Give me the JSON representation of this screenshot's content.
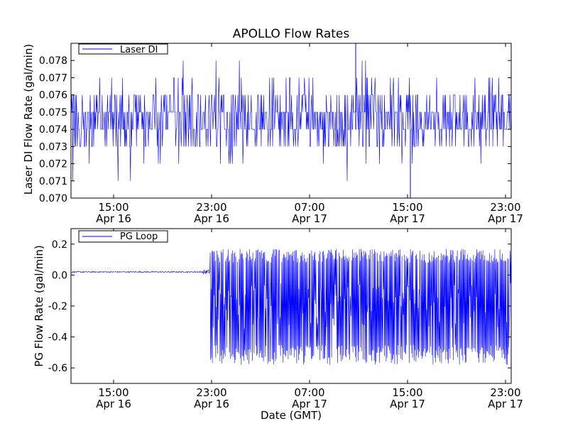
{
  "figure": {
    "title": "APOLLO Flow Rates",
    "xlabel": "Date (GMT)"
  },
  "colors": {
    "line": "#0000ff",
    "axes": "#000000",
    "background": "#ffffff"
  },
  "chart_data": [
    {
      "type": "line",
      "title": "APOLLO Flow Rates",
      "xlabel": "",
      "ylabel": "Laser DI Flow Rate (gal/min)",
      "x_range": [
        "Apr 16 10:30",
        "Apr 17 23:30"
      ],
      "ylim": [
        0.07,
        0.079
      ],
      "yticks": [
        "0.070",
        "0.071",
        "0.072",
        "0.073",
        "0.074",
        "0.075",
        "0.076",
        "0.077",
        "0.078"
      ],
      "xticks": [
        {
          "time": "15:00",
          "date": "Apr 16"
        },
        {
          "time": "23:00",
          "date": "Apr 16"
        },
        {
          "time": "07:00",
          "date": "Apr 17"
        },
        {
          "time": "15:00",
          "date": "Apr 17"
        },
        {
          "time": "23:00",
          "date": "Apr 17"
        }
      ],
      "legend": {
        "position": "top-left"
      },
      "grid": false,
      "series": [
        {
          "name": "Laser DI",
          "description_values": {
            "baseline": 0.0745,
            "typical_min": 0.073,
            "typical_max": 0.076,
            "min": 0.07,
            "max": 0.079
          }
        }
      ]
    },
    {
      "type": "line",
      "title": "",
      "xlabel": "Date (GMT)",
      "ylabel": "PG Flow Rate (gal/min)",
      "x_range": [
        "Apr 16 10:30",
        "Apr 17 23:30"
      ],
      "ylim": [
        -0.7,
        0.3
      ],
      "yticks": [
        "-0.6",
        "-0.4",
        "-0.2",
        "0.0",
        "0.2"
      ],
      "xticks": [
        {
          "time": "15:00",
          "date": "Apr 16"
        },
        {
          "time": "23:00",
          "date": "Apr 16"
        },
        {
          "time": "07:00",
          "date": "Apr 17"
        },
        {
          "time": "15:00",
          "date": "Apr 17"
        },
        {
          "time": "23:00",
          "date": "Apr 17"
        }
      ],
      "legend": {
        "position": "top-left"
      },
      "grid": false,
      "series": [
        {
          "name": "PG Loop",
          "description_values": {
            "stable_value": 0.02,
            "transition_time": "Apr 16 23:20",
            "after_transition_range": [
              -0.6,
              0.2
            ]
          }
        }
      ]
    }
  ]
}
